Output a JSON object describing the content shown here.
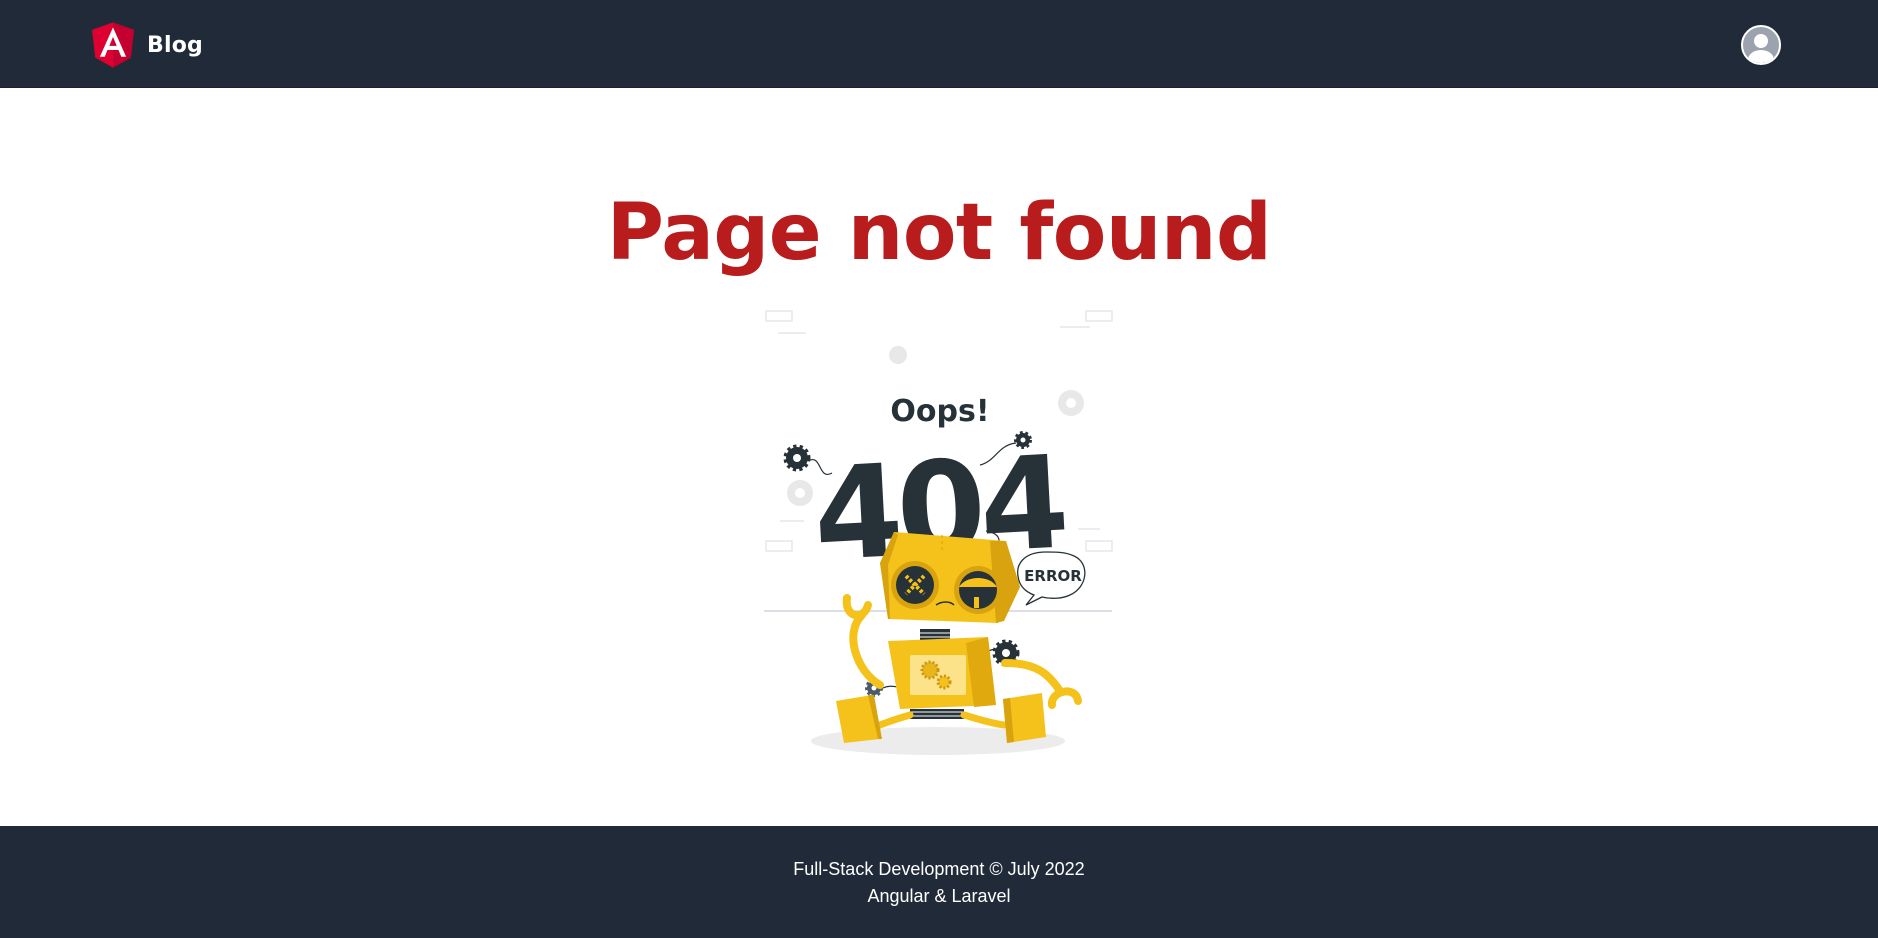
{
  "header": {
    "brand_label": "Blog",
    "logo_icon": "angular-logo-icon",
    "avatar_icon": "user-avatar-icon"
  },
  "main": {
    "title": "Page not found",
    "illustration": {
      "icon": "robot-404-illustration",
      "oops_text": "Oops!",
      "code_text": "404",
      "error_text": "ERROR"
    }
  },
  "footer": {
    "line1": "Full-Stack Development © July 2022",
    "line2": "Angular & Laravel"
  },
  "colors": {
    "navbar_bg": "#212a39",
    "title_red": "#b91c1c",
    "angular_red": "#dd0031",
    "robot_yellow": "#f5c21b",
    "dark_ink": "#263238"
  }
}
